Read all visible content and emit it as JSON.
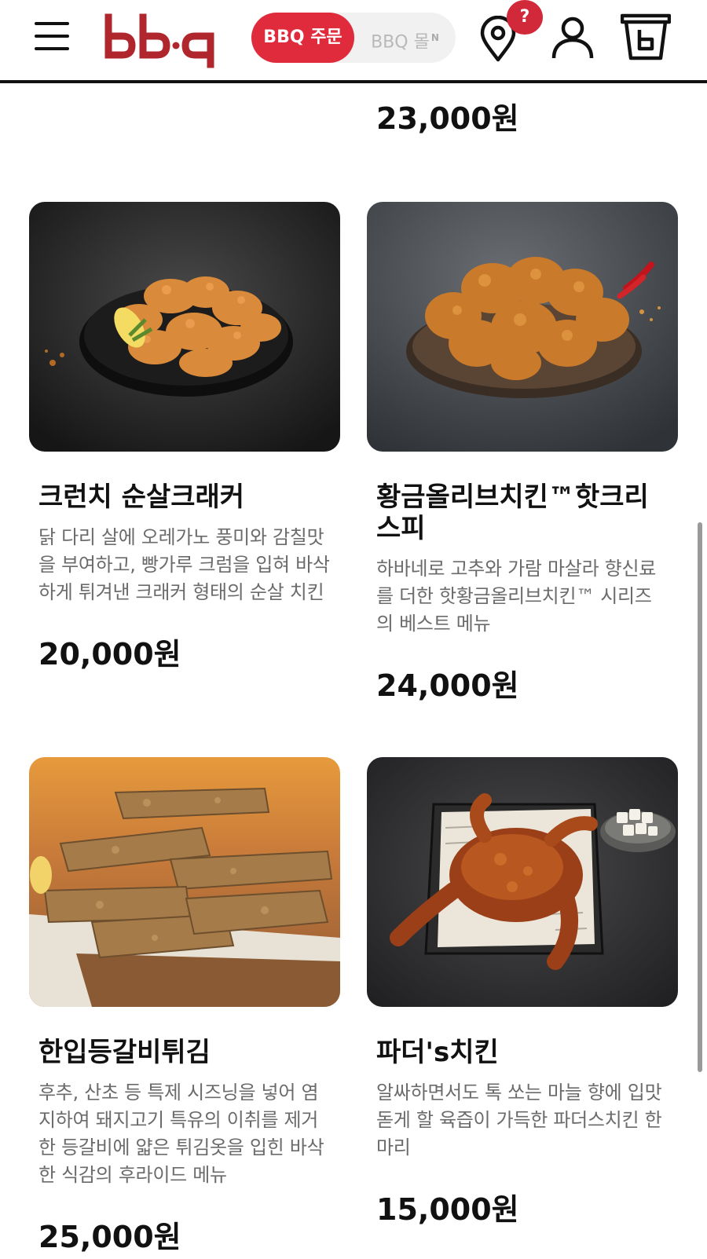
{
  "header": {
    "logo_text": "bb·q",
    "segment_active": "BBQ 주문",
    "segment_inactive": "BBQ 몰",
    "segment_inactive_badge": "N",
    "location_badge": "?",
    "brand_color": "#df2b3c"
  },
  "icons": [
    "menu-icon",
    "location-pin-icon",
    "user-icon",
    "cart-bucket-icon"
  ],
  "previous_item_price": "23,000원",
  "products": [
    {
      "name": "크런치 순살크래커",
      "description": "닭 다리 살에 오레가노 풍미와 감칠맛을 부여하고, 빵가루 크럼을 입혀 바삭하게 튀겨낸 크래커 형태의 순살 치킨",
      "price": "20,000원"
    },
    {
      "name": "황금올리브치킨™핫크리스피",
      "description": "하바네로 고추와 가람 마살라 향신료를 더한 핫황금올리브치킨™ 시리즈의 베스트 메뉴",
      "price": "24,000원"
    },
    {
      "name": "한입등갈비튀김",
      "description": "후추, 산초 등 특제 시즈닝을 넣어 염지하여 돼지고기 특유의 이취를 제거한 등갈비에 얇은 튀김옷을 입힌 바삭한 식감의 후라이드 메뉴",
      "price": "25,000원"
    },
    {
      "name": "파더's치킨",
      "description": "알싸하면서도 톡 쏘는 마늘 향에 입맛 돋게 할 육즙이 가득한 파더스치킨 한마리",
      "price": "15,000원"
    }
  ]
}
